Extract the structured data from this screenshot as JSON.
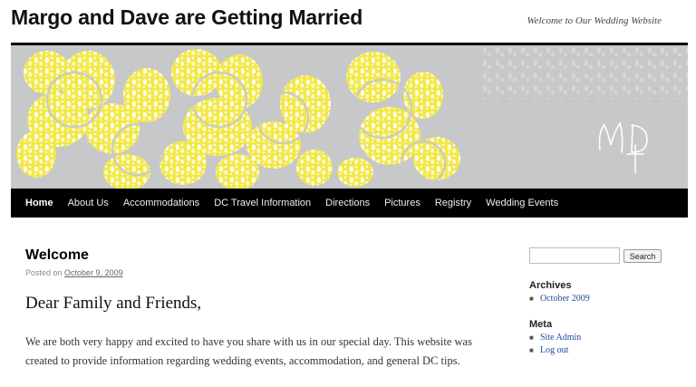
{
  "header": {
    "site_title": "Margo and Dave are Getting Married",
    "site_description": "Welcome to Our Wedding Website"
  },
  "banner": {
    "monogram": "MD",
    "colors": {
      "background": "#c7c8ca",
      "pattern": "#f2e84a"
    }
  },
  "nav": {
    "items": [
      {
        "label": "Home",
        "active": true
      },
      {
        "label": "About Us"
      },
      {
        "label": "Accommodations"
      },
      {
        "label": "DC Travel Information"
      },
      {
        "label": "Directions"
      },
      {
        "label": "Pictures"
      },
      {
        "label": "Registry"
      },
      {
        "label": "Wedding Events"
      }
    ]
  },
  "post": {
    "title": "Welcome",
    "posted_on_label": "Posted on",
    "date": "October 9, 2009",
    "greeting": "Dear Family and Friends,",
    "body": "We are both very happy and excited to have you share with us in our special day.  This website was created to provide information regarding wedding events, accommodation, and general DC tips."
  },
  "sidebar": {
    "search": {
      "value": "",
      "button_label": "Search"
    },
    "archives": {
      "title": "Archives",
      "items": [
        "October 2009"
      ]
    },
    "meta": {
      "title": "Meta",
      "items": [
        "Site Admin",
        "Log out"
      ]
    }
  }
}
